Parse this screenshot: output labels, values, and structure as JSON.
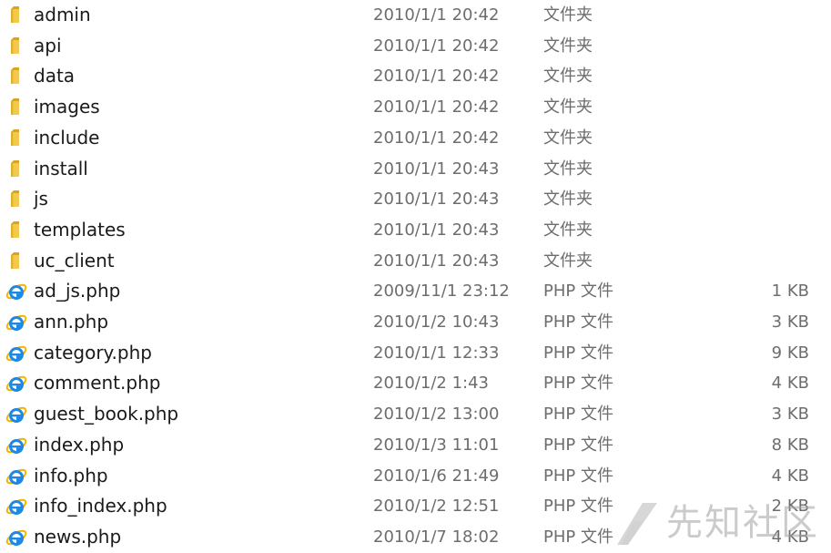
{
  "files": [
    {
      "icon": "folder-icon",
      "name": "admin",
      "date": "2010/1/1 20:42",
      "type": "文件夹",
      "size": ""
    },
    {
      "icon": "folder-icon",
      "name": "api",
      "date": "2010/1/1 20:42",
      "type": "文件夹",
      "size": ""
    },
    {
      "icon": "folder-icon",
      "name": "data",
      "date": "2010/1/1 20:42",
      "type": "文件夹",
      "size": ""
    },
    {
      "icon": "folder-icon",
      "name": "images",
      "date": "2010/1/1 20:42",
      "type": "文件夹",
      "size": ""
    },
    {
      "icon": "folder-icon",
      "name": "include",
      "date": "2010/1/1 20:42",
      "type": "文件夹",
      "size": ""
    },
    {
      "icon": "folder-icon",
      "name": "install",
      "date": "2010/1/1 20:43",
      "type": "文件夹",
      "size": ""
    },
    {
      "icon": "folder-icon",
      "name": "js",
      "date": "2010/1/1 20:43",
      "type": "文件夹",
      "size": ""
    },
    {
      "icon": "folder-icon",
      "name": "templates",
      "date": "2010/1/1 20:43",
      "type": "文件夹",
      "size": ""
    },
    {
      "icon": "folder-icon",
      "name": "uc_client",
      "date": "2010/1/1 20:43",
      "type": "文件夹",
      "size": ""
    },
    {
      "icon": "ie-file-icon",
      "name": "ad_js.php",
      "date": "2009/11/1 23:12",
      "type": "PHP 文件",
      "size": "1 KB"
    },
    {
      "icon": "ie-file-icon",
      "name": "ann.php",
      "date": "2010/1/2 10:43",
      "type": "PHP 文件",
      "size": "3 KB"
    },
    {
      "icon": "ie-file-icon",
      "name": "category.php",
      "date": "2010/1/1 12:33",
      "type": "PHP 文件",
      "size": "9 KB"
    },
    {
      "icon": "ie-file-icon",
      "name": "comment.php",
      "date": "2010/1/2 1:43",
      "type": "PHP 文件",
      "size": "4 KB"
    },
    {
      "icon": "ie-file-icon",
      "name": "guest_book.php",
      "date": "2010/1/2 13:00",
      "type": "PHP 文件",
      "size": "3 KB"
    },
    {
      "icon": "ie-file-icon",
      "name": "index.php",
      "date": "2010/1/3 11:01",
      "type": "PHP 文件",
      "size": "8 KB"
    },
    {
      "icon": "ie-file-icon",
      "name": "info.php",
      "date": "2010/1/6 21:49",
      "type": "PHP 文件",
      "size": "4 KB"
    },
    {
      "icon": "ie-file-icon",
      "name": "info_index.php",
      "date": "2010/1/2 12:51",
      "type": "PHP 文件",
      "size": "2 KB"
    },
    {
      "icon": "ie-file-icon",
      "name": "news.php",
      "date": "2010/1/7 18:02",
      "type": "PHP 文件",
      "size": "4 KB"
    }
  ],
  "watermark": {
    "text": "先知社区",
    "logo_icon": "xianzhi-logo-icon"
  },
  "colors": {
    "folder": "#f2c94c",
    "ie_blue": "#1e88e5",
    "ie_ring": "#f4b400",
    "text": "#1a1a1a",
    "muted": "#6d6d6d"
  }
}
